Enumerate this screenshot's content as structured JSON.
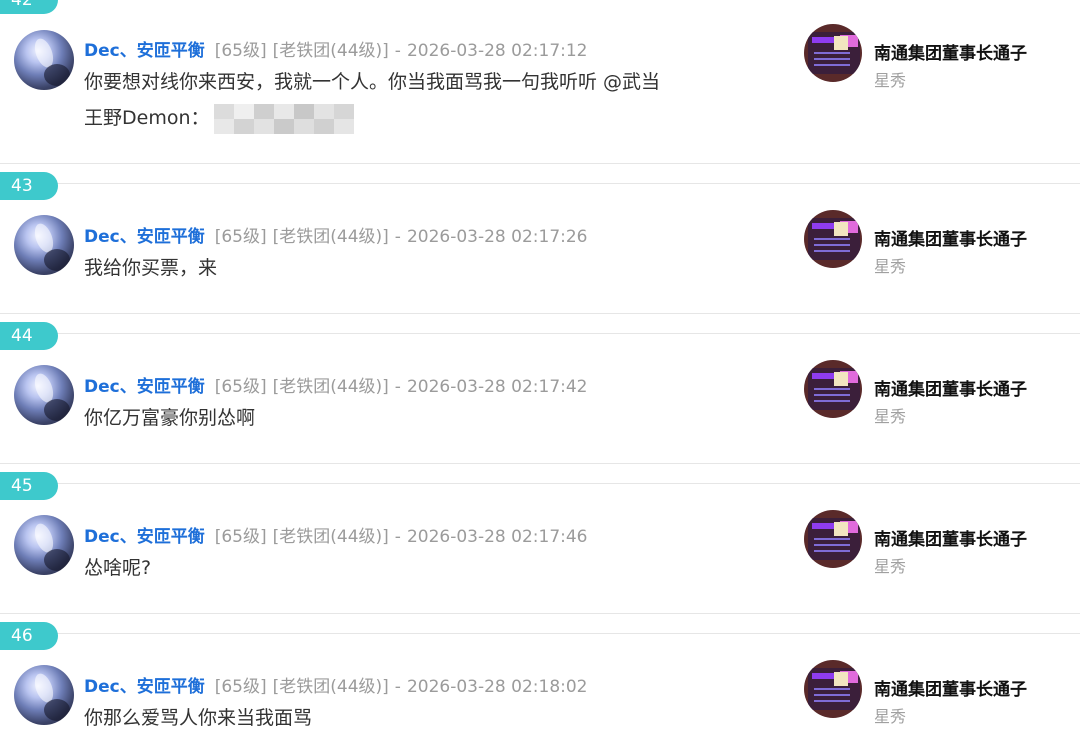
{
  "comments": [
    {
      "floor": "42",
      "user": "Dec、安匝平衡",
      "level": "[65级]",
      "group": "[老铁团(44级)]",
      "sep": "-",
      "time": "2026-03-28 02:17:12",
      "message_line1": "你要想对线你来西安，我就一个人。你当我面骂我一句我听听 @武当",
      "message_line2": "王野Demon：",
      "right_name": "南通集团董事长通子",
      "right_tag": "星秀"
    },
    {
      "floor": "43",
      "user": "Dec、安匝平衡",
      "level": "[65级]",
      "group": "[老铁团(44级)]",
      "sep": "-",
      "time": "2026-03-28 02:17:26",
      "message_line1": "我给你买票，来",
      "right_name": "南通集团董事长通子",
      "right_tag": "星秀"
    },
    {
      "floor": "44",
      "user": "Dec、安匝平衡",
      "level": "[65级]",
      "group": "[老铁团(44级)]",
      "sep": "-",
      "time": "2026-03-28 02:17:42",
      "message_line1": "你亿万富豪你别怂啊",
      "right_name": "南通集团董事长通子",
      "right_tag": "星秀"
    },
    {
      "floor": "45",
      "user": "Dec、安匝平衡",
      "level": "[65级]",
      "group": "[老铁团(44级)]",
      "sep": "-",
      "time": "2026-03-28 02:17:46",
      "message_line1": "怂啥呢?",
      "right_name": "南通集团董事长通子",
      "right_tag": "星秀"
    },
    {
      "floor": "46",
      "user": "Dec、安匝平衡",
      "level": "[65级]",
      "group": "[老铁团(44级)]",
      "sep": "-",
      "time": "2026-03-28 02:18:02",
      "message_line1": "你那么爱骂人你来当我面骂",
      "right_name": "南通集团董事长通子",
      "right_tag": "星秀"
    }
  ],
  "colors": {
    "floor_badge": "#3ec9cc",
    "username": "#1e6fd9",
    "meta_text": "#9b9b9b",
    "separator": "#e6e6e6"
  }
}
